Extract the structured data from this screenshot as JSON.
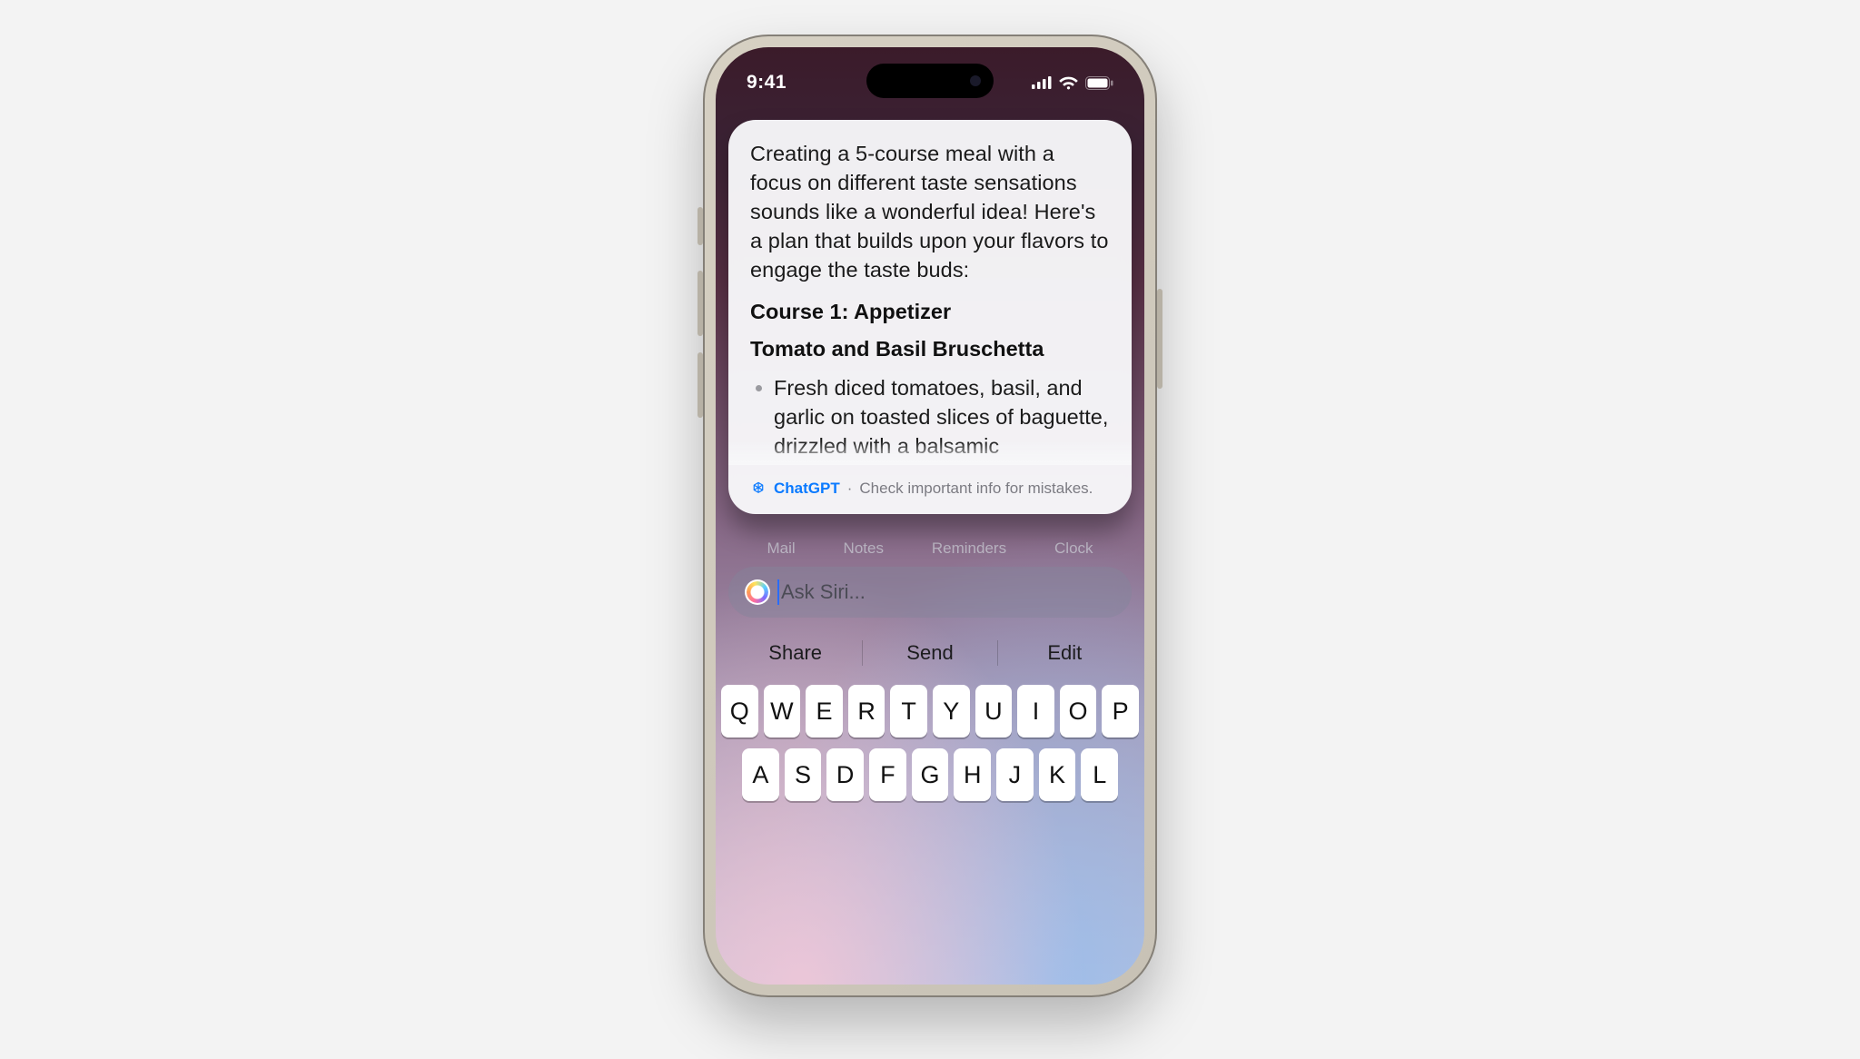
{
  "status": {
    "time": "9:41"
  },
  "response": {
    "intro": "Creating a 5-course meal with a focus on different taste sensations sounds like a wonderful idea! Here's a plan that builds upon your flavors to engage the taste buds:",
    "course_heading": "Course 1: Appetizer",
    "dish_heading": "Tomato and Basil Bruschetta",
    "bullet1": "Fresh diced tomatoes, basil, and garlic on toasted slices of baguette, drizzled with a balsamic",
    "source_label": "ChatGPT",
    "source_note": "Check important info for mistakes."
  },
  "home_labels": [
    "Mail",
    "Notes",
    "Reminders",
    "Clock"
  ],
  "siri": {
    "placeholder": "Ask Siri..."
  },
  "suggestions": [
    "Share",
    "Send",
    "Edit"
  ],
  "keyboard": {
    "row1": [
      "Q",
      "W",
      "E",
      "R",
      "T",
      "Y",
      "U",
      "I",
      "O",
      "P"
    ],
    "row2": [
      "A",
      "S",
      "D",
      "F",
      "G",
      "H",
      "J",
      "K",
      "L"
    ]
  }
}
